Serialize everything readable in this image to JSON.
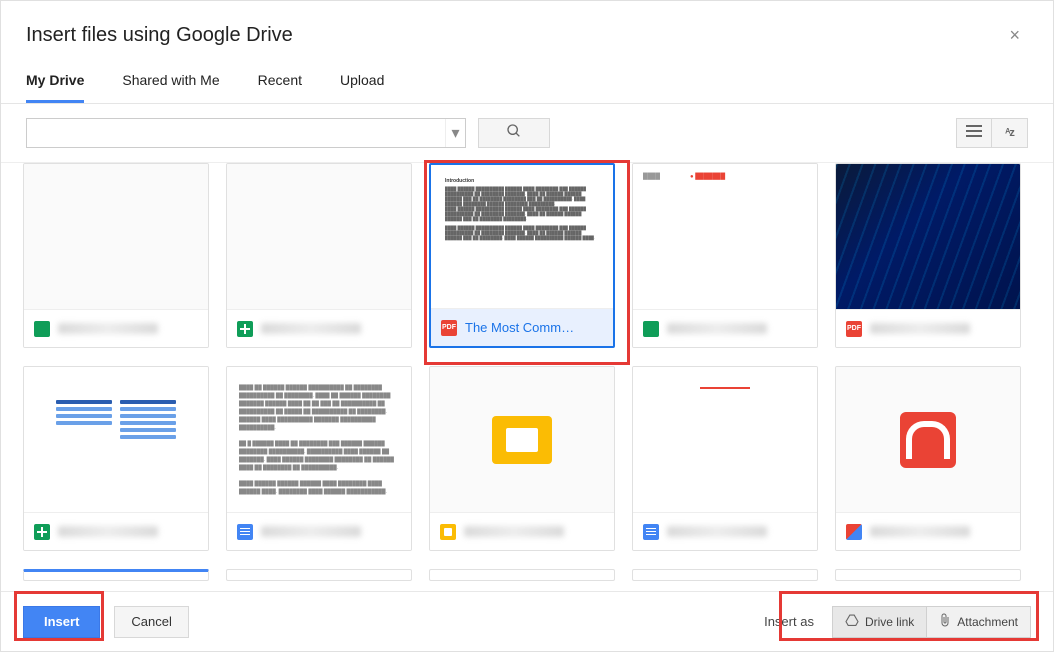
{
  "title": "Insert files using Google Drive",
  "tabs": [
    "My Drive",
    "Shared with Me",
    "Recent",
    "Upload"
  ],
  "active_tab": 0,
  "search": {
    "value": "",
    "placeholder": ""
  },
  "files_row1": [
    {
      "name": "████ ████",
      "type": "image"
    },
    {
      "name": "████ ████",
      "type": "sheet"
    },
    {
      "name": "The Most Comm…",
      "type": "pdf",
      "selected": true
    },
    {
      "name": "████ ████",
      "type": "image"
    },
    {
      "name": "████ ████",
      "type": "pdf"
    }
  ],
  "files_row2": [
    {
      "name": "████ ████",
      "type": "sheet"
    },
    {
      "name": "████ ████",
      "type": "doc"
    },
    {
      "name": "████ ████",
      "type": "slide"
    },
    {
      "name": "████ ████",
      "type": "doc"
    },
    {
      "name": "████ ████",
      "type": "image"
    }
  ],
  "footer": {
    "insert": "Insert",
    "cancel": "Cancel",
    "insert_as": "Insert as",
    "drive_link": "Drive link",
    "attachment": "Attachment"
  }
}
